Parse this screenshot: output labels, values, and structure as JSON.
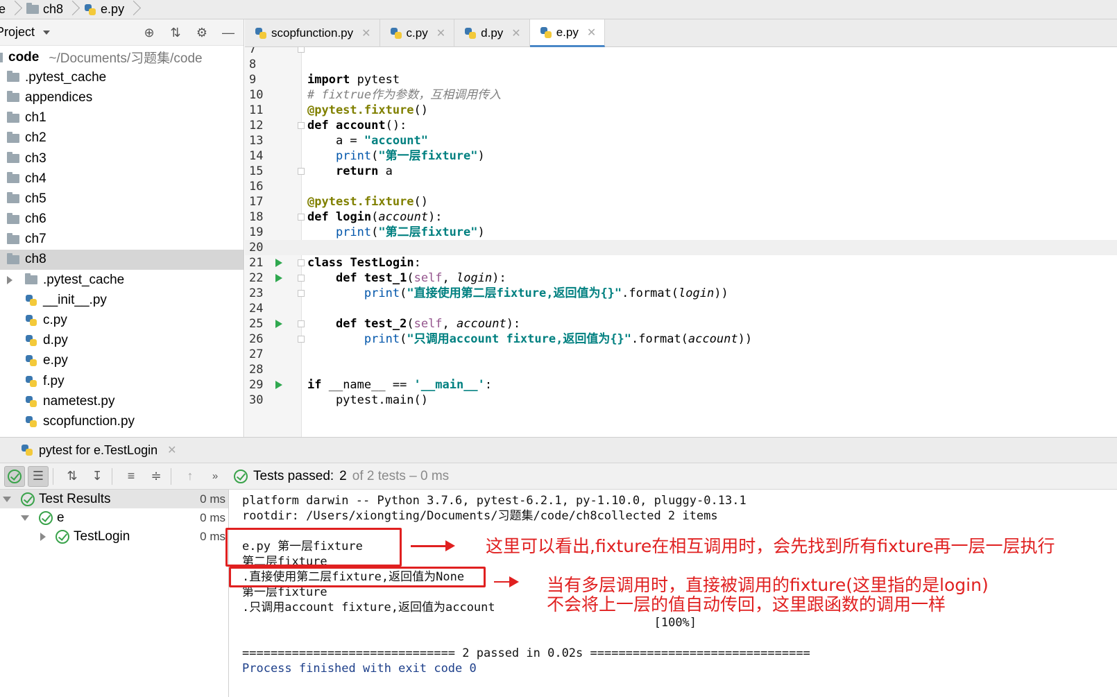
{
  "breadcrumb": [
    {
      "label": "e",
      "icon": "folder-icon"
    },
    {
      "label": "ch8",
      "icon": "folder-icon"
    },
    {
      "label": "e.py",
      "icon": "python-file-icon"
    }
  ],
  "project_panel": {
    "title": "Project",
    "root": {
      "name": "code",
      "path": "~/Documents/习题集/code"
    },
    "items": [
      {
        "label": ".pytest_cache",
        "type": "folder"
      },
      {
        "label": "appendices",
        "type": "folder"
      },
      {
        "label": "ch1",
        "type": "folder"
      },
      {
        "label": "ch2",
        "type": "folder"
      },
      {
        "label": "ch3",
        "type": "folder"
      },
      {
        "label": "ch4",
        "type": "folder"
      },
      {
        "label": "ch5",
        "type": "folder"
      },
      {
        "label": "ch6",
        "type": "folder"
      },
      {
        "label": "ch7",
        "type": "folder"
      },
      {
        "label": "ch8",
        "type": "folder",
        "selected": true
      },
      {
        "label": ".pytest_cache",
        "type": "folder",
        "child": true,
        "collapsed": true
      },
      {
        "label": "__init__.py",
        "type": "py",
        "child": true
      },
      {
        "label": "c.py",
        "type": "py",
        "child": true
      },
      {
        "label": "d.py",
        "type": "py",
        "child": true
      },
      {
        "label": "e.py",
        "type": "py",
        "child": true
      },
      {
        "label": "f.py",
        "type": "py",
        "child": true
      },
      {
        "label": "nametest.py",
        "type": "py",
        "child": true
      },
      {
        "label": "scopfunction.py",
        "type": "py",
        "child": true
      }
    ]
  },
  "editor_tabs": [
    {
      "label": "scopfunction.py",
      "active": false
    },
    {
      "label": "c.py",
      "active": false
    },
    {
      "label": "d.py",
      "active": false
    },
    {
      "label": "e.py",
      "active": true
    }
  ],
  "code_lines": [
    {
      "n": "7",
      "text": ""
    },
    {
      "n": "8",
      "text": ""
    },
    {
      "n": "9",
      "text": "import pytest"
    },
    {
      "n": "10",
      "text": "# fixtrue作为参数，互相调用传入"
    },
    {
      "n": "11",
      "text": "@pytest.fixture()"
    },
    {
      "n": "12",
      "text": "def account():"
    },
    {
      "n": "13",
      "text": "    a = \"account\""
    },
    {
      "n": "14",
      "text": "    print(\"第一层fixture\")"
    },
    {
      "n": "15",
      "text": "    return a"
    },
    {
      "n": "16",
      "text": ""
    },
    {
      "n": "17",
      "text": "@pytest.fixture()"
    },
    {
      "n": "18",
      "text": "def login(account):"
    },
    {
      "n": "19",
      "text": "    print(\"第二层fixture\")"
    },
    {
      "n": "20",
      "text": ""
    },
    {
      "n": "21",
      "text": "class TestLogin:"
    },
    {
      "n": "22",
      "text": "    def test_1(self, login):"
    },
    {
      "n": "23",
      "text": "        print(\"直接使用第二层fixture,返回值为{}\".format(login))"
    },
    {
      "n": "24",
      "text": ""
    },
    {
      "n": "25",
      "text": "    def test_2(self, account):"
    },
    {
      "n": "26",
      "text": "        print(\"只调用account fixture,返回值为{}\".format(account))"
    },
    {
      "n": "27",
      "text": ""
    },
    {
      "n": "28",
      "text": ""
    },
    {
      "n": "29",
      "text": "if __name__ == '__main__':"
    },
    {
      "n": "30",
      "text": "    pytest.main()"
    }
  ],
  "run_panel": {
    "tab_label": "pytest for e.TestLogin",
    "status": {
      "label": "Tests passed:",
      "passed": "2",
      "of_text": "of 2 tests – 0 ms"
    },
    "results": [
      {
        "label": "Test Results",
        "time": "0 ms"
      },
      {
        "label": "e",
        "time": "0 ms"
      },
      {
        "label": "TestLogin",
        "time": "0 ms"
      }
    ],
    "console": [
      "platform darwin -- Python 3.7.6, pytest-6.2.1, py-1.10.0, pluggy-0.13.1",
      "rootdir: /Users/xiongting/Documents/习题集/code/ch8collected 2 items",
      "",
      "e.py 第一层fixture",
      "第二层fixture",
      ".直接使用第二层fixture,返回值为None",
      "第一层fixture",
      ".只调用account fixture,返回值为account",
      "                                                          [100%]",
      "",
      "============================== 2 passed in 0.02s ===============================",
      "Process finished with exit code 0"
    ]
  },
  "annotations": {
    "note1": "这里可以看出,fixture在相互调用时，会先找到所有fixture再一层一层执行",
    "note2_line1": "当有多层调用时，直接被调用的fixture(这里指的是login)",
    "note2_line2": "不会将上一层的值自动传回，这里跟函数的调用一样"
  },
  "colors": {
    "accent": "#4a88c7",
    "pass_green": "#3aa34b",
    "annotation_red": "#e02020"
  }
}
